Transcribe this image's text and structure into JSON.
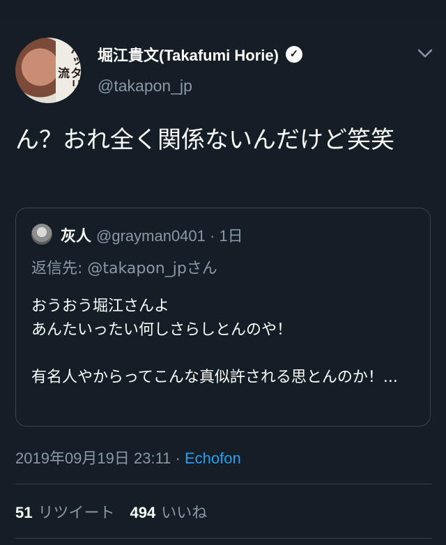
{
  "tweet": {
    "author_name": "堀江貴文(Takafumi Horie)",
    "author_handle": "@takapon_jp",
    "avatar_book_text": "ハッタリの流",
    "text": "ん？おれ全く関係ないんだけど笑笑",
    "timestamp": "2019年09月19日 23:11",
    "separator": " · ",
    "source_app": "Echofon"
  },
  "icons": {
    "verified": "verified-badge-icon",
    "more": "chevron-down-icon"
  },
  "quoted": {
    "author_name": "灰人",
    "author_handle": "@grayman0401",
    "time_ago": " · 1日",
    "reply_to": "返信先: @takapon_jpさん",
    "text": "おうおう堀江さんよ\nあんたいったい何しさらしとんのや！\n\n有名人やからってこんな真似許される思とんのか！..."
  },
  "stats": {
    "retweets_count": "51",
    "retweets_label": "リツイート",
    "likes_count": "494",
    "likes_label": "いいね"
  },
  "colors": {
    "background": "#151d27",
    "secondary_text": "#8b98a5",
    "link": "#1da1f2",
    "border": "#38444d"
  }
}
